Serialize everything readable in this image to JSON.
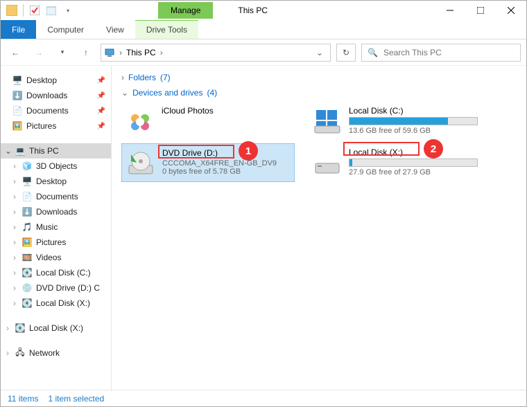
{
  "title": "This PC",
  "contextual_tab": "Manage",
  "contextual_group": "Drive Tools",
  "ribbon": {
    "file": "File",
    "tabs": [
      "Computer",
      "View"
    ]
  },
  "address": {
    "location": "This PC",
    "search_placeholder": "Search This PC"
  },
  "tree": {
    "quick": [
      {
        "label": "Desktop",
        "icon": "desktop",
        "pinned": true
      },
      {
        "label": "Downloads",
        "icon": "downloads",
        "pinned": true
      },
      {
        "label": "Documents",
        "icon": "documents",
        "pinned": true
      },
      {
        "label": "Pictures",
        "icon": "pictures",
        "pinned": true
      }
    ],
    "thispc_label": "This PC",
    "thispc_children": [
      {
        "label": "3D Objects",
        "icon": "3d"
      },
      {
        "label": "Desktop",
        "icon": "desktop"
      },
      {
        "label": "Documents",
        "icon": "documents"
      },
      {
        "label": "Downloads",
        "icon": "downloads"
      },
      {
        "label": "Music",
        "icon": "music"
      },
      {
        "label": "Pictures",
        "icon": "pictures"
      },
      {
        "label": "Videos",
        "icon": "videos"
      },
      {
        "label": "Local Disk (C:)",
        "icon": "disk"
      },
      {
        "label": "DVD Drive (D:) C",
        "icon": "dvd"
      },
      {
        "label": "Local Disk (X:)",
        "icon": "disk"
      }
    ],
    "extra": [
      {
        "label": "Local Disk (X:)",
        "icon": "disk"
      },
      {
        "label": "Network",
        "icon": "network"
      }
    ]
  },
  "sections": {
    "folders": {
      "label": "Folders",
      "count": "(7)"
    },
    "devices": {
      "label": "Devices and drives",
      "count": "(4)"
    }
  },
  "devices": {
    "icloud": {
      "title": "iCloud Photos"
    },
    "c": {
      "title": "Local Disk (C:)",
      "free": "13.6 GB free of 59.6 GB",
      "fill_pct": 77
    },
    "dvd": {
      "title": "DVD Drive (D:)",
      "sub1": "CCCOMA_X64FRE_EN-GB_DV9",
      "sub2": "0 bytes free of 5.78 GB"
    },
    "x": {
      "title": "Local Disk (X:)",
      "free": "27.9 GB free of 27.9 GB",
      "fill_pct": 2
    }
  },
  "callouts": {
    "one": "1",
    "two": "2"
  },
  "status": {
    "items": "11 items",
    "selected": "1 item selected"
  }
}
